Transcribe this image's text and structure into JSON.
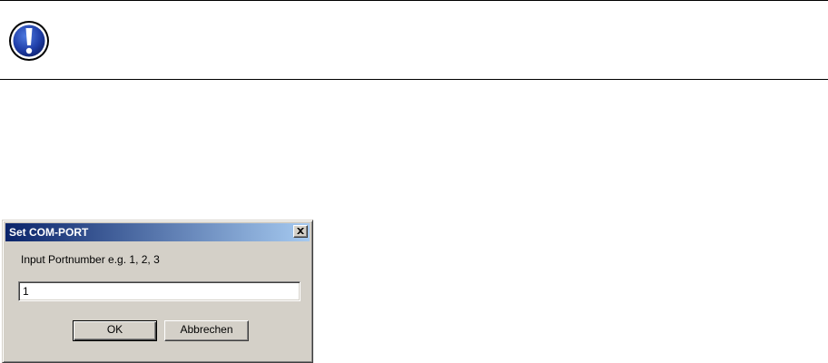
{
  "notice": {
    "icon": "exclamation-icon",
    "icon_color": "#1f3ea8"
  },
  "dialog": {
    "title": "Set COM-PORT",
    "close_icon": "close-icon",
    "prompt": "Input Portnumber e.g. 1, 2, 3",
    "port_value": "1",
    "ok_label": "OK",
    "cancel_label": "Abbrechen",
    "titlebar_colors": [
      "#0a246a",
      "#a6caf0"
    ],
    "face_color": "#d4d0c8"
  }
}
